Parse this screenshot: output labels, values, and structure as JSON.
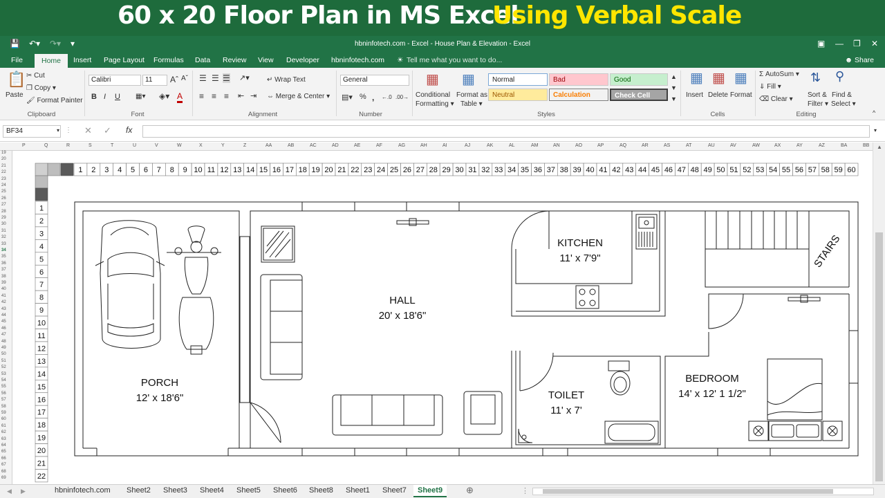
{
  "banner": {
    "title_main": "60 x 20 Floor Plan in MS Excel",
    "title_accent": "Using Verbal Scale"
  },
  "window": {
    "title": "hbninfotech.com - Excel - House Plan & Elevation - Excel"
  },
  "tabs": [
    {
      "label": "File"
    },
    {
      "label": "Home"
    },
    {
      "label": "Insert"
    },
    {
      "label": "Page Layout"
    },
    {
      "label": "Formulas"
    },
    {
      "label": "Data"
    },
    {
      "label": "Review"
    },
    {
      "label": "View"
    },
    {
      "label": "Developer"
    },
    {
      "label": "hbninfotech.com"
    }
  ],
  "tell_me": "Tell me what you want to do...",
  "share_label": "Share",
  "ribbon": {
    "clipboard": {
      "paste": "Paste",
      "cut": "Cut",
      "copy": "Copy",
      "format_painter": "Format Painter",
      "group": "Clipboard"
    },
    "font": {
      "name": "Calibri",
      "size": "11",
      "bold": "B",
      "italic": "I",
      "underline": "U",
      "color": "A",
      "group": "Font"
    },
    "alignment": {
      "wrap": "Wrap Text",
      "merge": "Merge & Center",
      "group": "Alignment"
    },
    "number": {
      "format": "General",
      "percent": "%",
      "comma": ",",
      "dec_inc": "←.0",
      "dec_dec": ".00→",
      "group": "Number"
    },
    "styles": {
      "cond": "Conditional",
      "cond2": "Formatting",
      "fmt_table": "Format as",
      "fmt_table2": "Table",
      "normal": "Normal",
      "bad": "Bad",
      "good": "Good",
      "neutral": "Neutral",
      "calculation": "Calculation",
      "check_cell": "Check Cell",
      "group": "Styles"
    },
    "cells": {
      "insert": "Insert",
      "delete": "Delete",
      "format": "Format",
      "group": "Cells"
    },
    "editing": {
      "autosum": "AutoSum",
      "fill": "Fill",
      "clear": "Clear",
      "sort": "Sort &",
      "sort2": "Filter",
      "find": "Find &",
      "find2": "Select",
      "group": "Editing"
    }
  },
  "formula_bar": {
    "name_box": "BF34",
    "fx": "fx",
    "content": ""
  },
  "column_headers": [
    "P",
    "Q",
    "R",
    "S",
    "T",
    "U",
    "V",
    "W",
    "X",
    "Y",
    "Z",
    "AA",
    "AB",
    "AC",
    "AD",
    "AE",
    "AF",
    "AG",
    "AH",
    "AI",
    "AJ",
    "AK",
    "AL",
    "AM",
    "AN",
    "AO",
    "AP",
    "AQ",
    "AR",
    "AS",
    "AT",
    "AU",
    "AV",
    "AW",
    "AX",
    "AY",
    "AZ",
    "BA",
    "BB"
  ],
  "row_headers": [
    "19",
    "20",
    "21",
    "22",
    "23",
    "24",
    "25",
    "26",
    "27",
    "28",
    "29",
    "30",
    "31",
    "32",
    "33",
    "34",
    "35",
    "36",
    "37",
    "38",
    "39",
    "40",
    "41",
    "42",
    "43",
    "44",
    "45",
    "46",
    "47",
    "48",
    "49",
    "50",
    "51",
    "52",
    "53",
    "54",
    "55",
    "56",
    "57",
    "58",
    "59",
    "60",
    "61",
    "62",
    "63",
    "64",
    "65",
    "66",
    "67",
    "68",
    "69"
  ],
  "scale": {
    "horizontal": [
      "1",
      "2",
      "3",
      "4",
      "5",
      "6",
      "7",
      "8",
      "9",
      "10",
      "11",
      "12",
      "13",
      "14",
      "15",
      "16",
      "17",
      "18",
      "19",
      "20",
      "21",
      "22",
      "23",
      "24",
      "25",
      "26",
      "27",
      "28",
      "29",
      "30",
      "31",
      "32",
      "33",
      "34",
      "35",
      "36",
      "37",
      "38",
      "39",
      "40",
      "41",
      "42",
      "43",
      "44",
      "45",
      "46",
      "47",
      "48",
      "49",
      "50",
      "51",
      "52",
      "53",
      "54",
      "55",
      "56",
      "57",
      "58",
      "59",
      "60"
    ],
    "vertical": [
      "1",
      "2",
      "3",
      "4",
      "5",
      "6",
      "7",
      "8",
      "9",
      "10",
      "11",
      "12",
      "13",
      "14",
      "15",
      "16",
      "17",
      "18",
      "19",
      "20",
      "21",
      "22"
    ]
  },
  "rooms": {
    "porch": {
      "name": "PORCH",
      "size": "12' x 18'6\""
    },
    "hall": {
      "name": "HALL",
      "size": "20' x 18'6\""
    },
    "kitchen": {
      "name": "KITCHEN",
      "size": "11' x 7'9\""
    },
    "toilet": {
      "name": "TOILET",
      "size": "11' x 7'"
    },
    "bedroom": {
      "name": "BEDROOM",
      "size": "14' x 12' 1 1/2\""
    },
    "stairs": {
      "name": "STAIRS"
    }
  },
  "sheet_tabs": [
    {
      "label": "hbninfotech.com"
    },
    {
      "label": "Sheet2"
    },
    {
      "label": "Sheet3"
    },
    {
      "label": "Sheet4"
    },
    {
      "label": "Sheet5"
    },
    {
      "label": "Sheet6"
    },
    {
      "label": "Sheet8"
    },
    {
      "label": "Sheet1"
    },
    {
      "label": "Sheet7"
    },
    {
      "label": "Sheet9"
    }
  ],
  "active_sheet": "Sheet9",
  "colors": {
    "excel_green": "#217346",
    "banner_green": "#1e6b3c",
    "accent_yellow": "#ffe600"
  }
}
